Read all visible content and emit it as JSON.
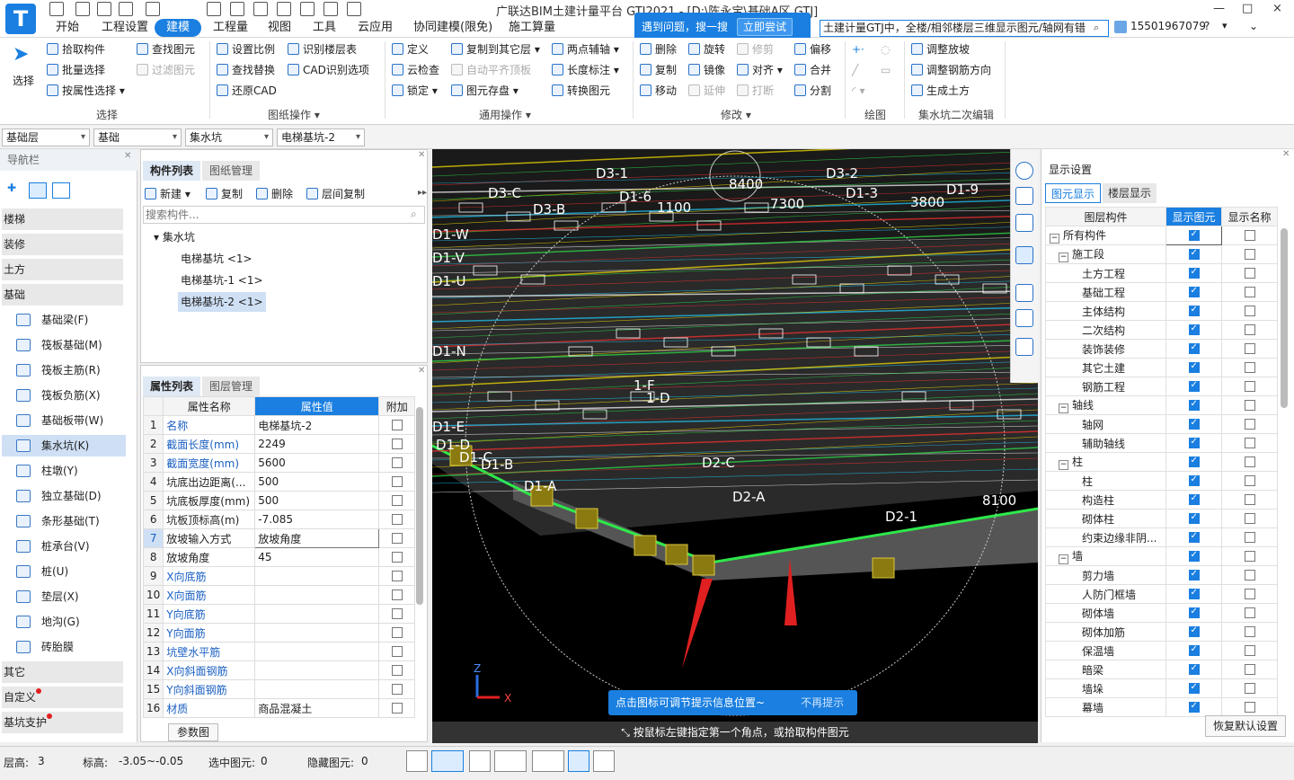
{
  "app": {
    "title": "广联达BIM土建计量平台 GTJ2021 - [D:\\陈永宝\\基础A区.GTJ]",
    "logo_text": "T",
    "user_phone": "15501967079"
  },
  "menu_tabs": [
    "开始",
    "工程设置",
    "建模",
    "工程量",
    "视图",
    "工具",
    "云应用",
    "协同建模(限免)",
    "施工算量"
  ],
  "search_tip": {
    "text": "遇到问题，搜一搜",
    "button": "立即尝试"
  },
  "search_box": {
    "value": "土建计量GTJ中，全楼/相邻楼层三维显示图元/轴网有错"
  },
  "window_controls": [
    "?",
    "—",
    "□",
    "×"
  ],
  "ribbon": {
    "select": {
      "label": "选择",
      "items": [
        "拾取构件",
        "批量选择",
        "按属性选择"
      ],
      "items2": [
        "查找图元",
        "过滤图元"
      ],
      "group": "选择"
    },
    "drawing": {
      "items": [
        "设置比例",
        "查找替换",
        "还原CAD"
      ],
      "items2": [
        "识别楼层表",
        "CAD识别选项"
      ],
      "group": "图纸操作"
    },
    "common": {
      "items": [
        "定义",
        "云检查",
        "锁定"
      ],
      "items2": [
        "复制到其它层",
        "自动平齐顶板",
        "图元存盘"
      ],
      "items3": [
        "两点辅轴",
        "长度标注",
        "转换图元"
      ],
      "group": "通用操作"
    },
    "modify": {
      "items": [
        "删除",
        "复制",
        "移动"
      ],
      "items2": [
        "旋转",
        "镜像",
        "延伸"
      ],
      "items3": [
        "修剪",
        "对齐",
        "打断"
      ],
      "items4": [
        "偏移",
        "合并",
        "分割"
      ],
      "group": "修改"
    },
    "draw": {
      "group": "绘图"
    },
    "pit": {
      "items": [
        "调整放坡",
        "调整钢筋方向",
        "生成土方"
      ],
      "group": "集水坑二次编辑"
    }
  },
  "selectors": [
    "基础层",
    "基础",
    "集水坑",
    "电梯基坑-2"
  ],
  "nav": {
    "header": "导航栏",
    "sections": [
      "楼梯",
      "装修",
      "土方",
      "基础"
    ],
    "items": [
      "基础梁(F)",
      "筏板基础(M)",
      "筏板主筋(R)",
      "筏板负筋(X)",
      "基础板带(W)",
      "集水坑(K)",
      "柱墩(Y)",
      "独立基础(D)",
      "条形基础(T)",
      "桩承台(V)",
      "桩(U)",
      "垫层(X)",
      "地沟(G)",
      "砖胎膜"
    ],
    "bottom_sections": [
      "其它",
      "自定义",
      "基坑支护"
    ]
  },
  "component_list": {
    "tabs": [
      "构件列表",
      "图纸管理"
    ],
    "toolbar": [
      "新建",
      "复制",
      "删除",
      "层间复制"
    ],
    "search_placeholder": "搜索构件...",
    "tree_root": "集水坑",
    "items": [
      "电梯基坑 <1>",
      "电梯基坑-1 <1>",
      "电梯基坑-2 <1>"
    ]
  },
  "properties": {
    "tabs": [
      "属性列表",
      "图层管理"
    ],
    "headers": [
      "属性名称",
      "属性值",
      "附加"
    ],
    "rows": [
      {
        "no": "1",
        "name": "名称",
        "value": "电梯基坑-2"
      },
      {
        "no": "2",
        "name": "截面长度(mm)",
        "value": "2249"
      },
      {
        "no": "3",
        "name": "截面宽度(mm)",
        "value": "5600"
      },
      {
        "no": "4",
        "name": "坑底出边距离(...",
        "value": "500"
      },
      {
        "no": "5",
        "name": "坑底板厚度(mm)",
        "value": "500"
      },
      {
        "no": "6",
        "name": "坑板顶标高(m)",
        "value": "-7.085"
      },
      {
        "no": "7",
        "name": "放坡输入方式",
        "value": "放坡角度"
      },
      {
        "no": "8",
        "name": "放坡角度",
        "value": "45"
      },
      {
        "no": "9",
        "name": "X向底筋",
        "value": ""
      },
      {
        "no": "10",
        "name": "X向面筋",
        "value": ""
      },
      {
        "no": "11",
        "name": "Y向底筋",
        "value": ""
      },
      {
        "no": "12",
        "name": "Y向面筋",
        "value": ""
      },
      {
        "no": "13",
        "name": "坑壁水平筋",
        "value": ""
      },
      {
        "no": "14",
        "name": "X向斜面钢筋",
        "value": ""
      },
      {
        "no": "15",
        "name": "Y向斜面钢筋",
        "value": ""
      },
      {
        "no": "16",
        "name": "材质",
        "value": "商品混凝土"
      }
    ],
    "param_button": "参数图"
  },
  "viewport": {
    "labels": [
      "D3-1",
      "D3-2",
      "8400",
      "7300",
      "3800",
      "D1-9",
      "D1-3",
      "D3-C",
      "D3-B",
      "D1-6",
      "1100",
      "D1-W",
      "D1-V",
      "D1-U",
      "D1-N",
      "D1-E",
      "D1-D",
      "D1-C",
      "D1-B",
      "D1-A",
      "D2-1",
      "D2-A",
      "D2-C",
      "8100",
      "1-F",
      "1-D"
    ],
    "hint": "点击图标可调节提示信息位置~",
    "hint_button": "不再提示",
    "status_message": "按鼠标左键指定第一个角点，或拾取构件图元",
    "axes": [
      "Z",
      "X"
    ]
  },
  "display": {
    "title": "显示设置",
    "tabs": [
      "图元显示",
      "楼层显示"
    ],
    "headers": [
      "图层构件",
      "显示图元",
      "显示名称"
    ],
    "rows": [
      {
        "name": "所有构件",
        "level": 0,
        "group": true,
        "disp": true,
        "nm": false
      },
      {
        "name": "施工段",
        "level": 1,
        "group": true,
        "disp": true,
        "nm": false
      },
      {
        "name": "土方工程",
        "level": 2,
        "group": false,
        "disp": true,
        "nm": false
      },
      {
        "name": "基础工程",
        "level": 2,
        "group": false,
        "disp": true,
        "nm": false
      },
      {
        "name": "主体结构",
        "level": 2,
        "group": false,
        "disp": true,
        "nm": false
      },
      {
        "name": "二次结构",
        "level": 2,
        "group": false,
        "disp": true,
        "nm": false
      },
      {
        "name": "装饰装修",
        "level": 2,
        "group": false,
        "disp": true,
        "nm": false
      },
      {
        "name": "其它土建",
        "level": 2,
        "group": false,
        "disp": true,
        "nm": false
      },
      {
        "name": "钢筋工程",
        "level": 2,
        "group": false,
        "disp": true,
        "nm": false
      },
      {
        "name": "轴线",
        "level": 1,
        "group": true,
        "disp": true,
        "nm": false
      },
      {
        "name": "轴网",
        "level": 2,
        "group": false,
        "disp": true,
        "nm": false
      },
      {
        "name": "辅助轴线",
        "level": 2,
        "group": false,
        "disp": true,
        "nm": false
      },
      {
        "name": "柱",
        "level": 1,
        "group": true,
        "disp": true,
        "nm": false
      },
      {
        "name": "柱",
        "level": 2,
        "group": false,
        "disp": true,
        "nm": false
      },
      {
        "name": "构造柱",
        "level": 2,
        "group": false,
        "disp": true,
        "nm": false
      },
      {
        "name": "砌体柱",
        "level": 2,
        "group": false,
        "disp": true,
        "nm": false
      },
      {
        "name": "约束边缘非阴...",
        "level": 2,
        "group": false,
        "disp": true,
        "nm": false
      },
      {
        "name": "墙",
        "level": 1,
        "group": true,
        "disp": true,
        "nm": false
      },
      {
        "name": "剪力墙",
        "level": 2,
        "group": false,
        "disp": true,
        "nm": false
      },
      {
        "name": "人防门框墙",
        "level": 2,
        "group": false,
        "disp": true,
        "nm": false
      },
      {
        "name": "砌体墙",
        "level": 2,
        "group": false,
        "disp": true,
        "nm": false
      },
      {
        "name": "砌体加筋",
        "level": 2,
        "group": false,
        "disp": true,
        "nm": false
      },
      {
        "name": "保温墙",
        "level": 2,
        "group": false,
        "disp": true,
        "nm": false
      },
      {
        "name": "暗梁",
        "level": 2,
        "group": false,
        "disp": true,
        "nm": false
      },
      {
        "name": "墙垛",
        "level": 2,
        "group": false,
        "disp": true,
        "nm": false
      },
      {
        "name": "幕墙",
        "level": 2,
        "group": false,
        "disp": true,
        "nm": false
      }
    ],
    "restore_button": "恢复默认设置"
  },
  "statusbar": {
    "floor_label": "层高:",
    "floor_value": "3",
    "elev_label": "标高:",
    "elev_value": "-3.05~-0.05",
    "selected_label": "选中图元:",
    "selected_value": "0",
    "hidden_label": "隐藏图元:",
    "hidden_value": "0"
  },
  "colors": {
    "accent": "#1a7fe0",
    "viewport_bg": "#000000"
  }
}
